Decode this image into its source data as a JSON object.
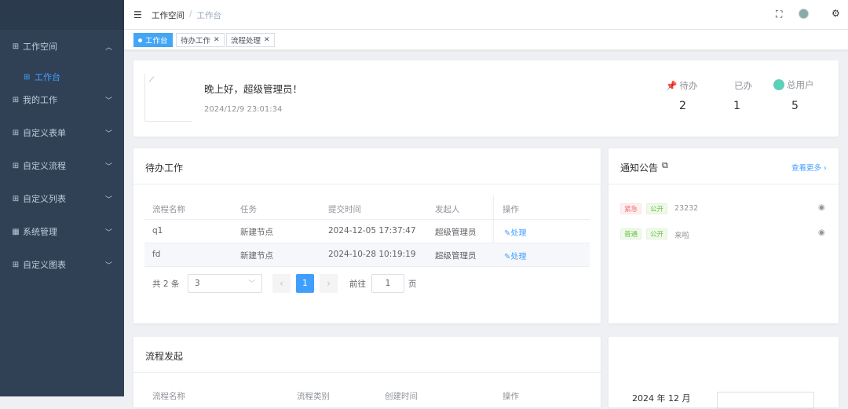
{
  "sidebar": {
    "items": [
      {
        "label": "工作空间",
        "icon": "grid-icon",
        "chevron": "︿"
      },
      {
        "label": "工作台",
        "icon": "grid-icon"
      },
      {
        "label": "我的工作",
        "icon": "grid-icon",
        "chevron": "﹀"
      },
      {
        "label": "自定义表单",
        "icon": "grid-icon",
        "chevron": "﹀"
      },
      {
        "label": "自定义流程",
        "icon": "grid-icon",
        "chevron": "﹀"
      },
      {
        "label": "自定义列表",
        "icon": "grid-icon",
        "chevron": "﹀"
      },
      {
        "label": "系统管理",
        "icon": "table-icon",
        "chevron": "﹀"
      },
      {
        "label": "自定义图表",
        "icon": "grid-icon",
        "chevron": "﹀"
      }
    ]
  },
  "navbar": {
    "breadcrumb": [
      "工作空间",
      "/",
      "工作台"
    ]
  },
  "tags": [
    {
      "label": "工作台",
      "active": true
    },
    {
      "label": "待办工作",
      "close": "✕"
    },
    {
      "label": "流程处理",
      "close": "✕"
    }
  ],
  "welcome": {
    "greeting": "晚上好，超级管理员！",
    "datetime": "2024/12/9 23:01:34",
    "stats": [
      {
        "label": "待办",
        "value": "2"
      },
      {
        "label": "已办",
        "value": "1"
      },
      {
        "label": "总用户",
        "value": "5"
      }
    ]
  },
  "todo": {
    "title": "待办工作",
    "columns": [
      "流程名称",
      "任务",
      "提交时间",
      "发起人",
      "操作"
    ],
    "rows": [
      {
        "name": "q1",
        "task": "新建节点",
        "time": "2024-12-05 17:37:47",
        "initiator": "超级管理员",
        "action": "处理"
      },
      {
        "name": "fd",
        "task": "新建节点",
        "time": "2024-10-28 10:19:19",
        "initiator": "超级管理员",
        "action": "处理"
      }
    ],
    "pagination": {
      "total": "共 2 条",
      "page_size": "3",
      "prev": "‹",
      "current": "1",
      "next": "›",
      "goto_label": "前往",
      "goto_value": "1",
      "page_suffix": "页"
    }
  },
  "notice": {
    "title": "通知公告",
    "more": "查看更多",
    "items": [
      {
        "level": "紧急",
        "scope": "公开",
        "title": "23232"
      },
      {
        "level": "普通",
        "scope": "公开",
        "title": "来啦"
      }
    ]
  },
  "flow_start": {
    "title": "流程发起",
    "columns": [
      "流程名称",
      "流程类别",
      "创建时间",
      "操作"
    ]
  },
  "calendar": {
    "header": "2024 年 12 月"
  },
  "colors": {
    "sidebar": "#304156",
    "accent": "#409eff",
    "active_tag": "#42a5f5"
  }
}
